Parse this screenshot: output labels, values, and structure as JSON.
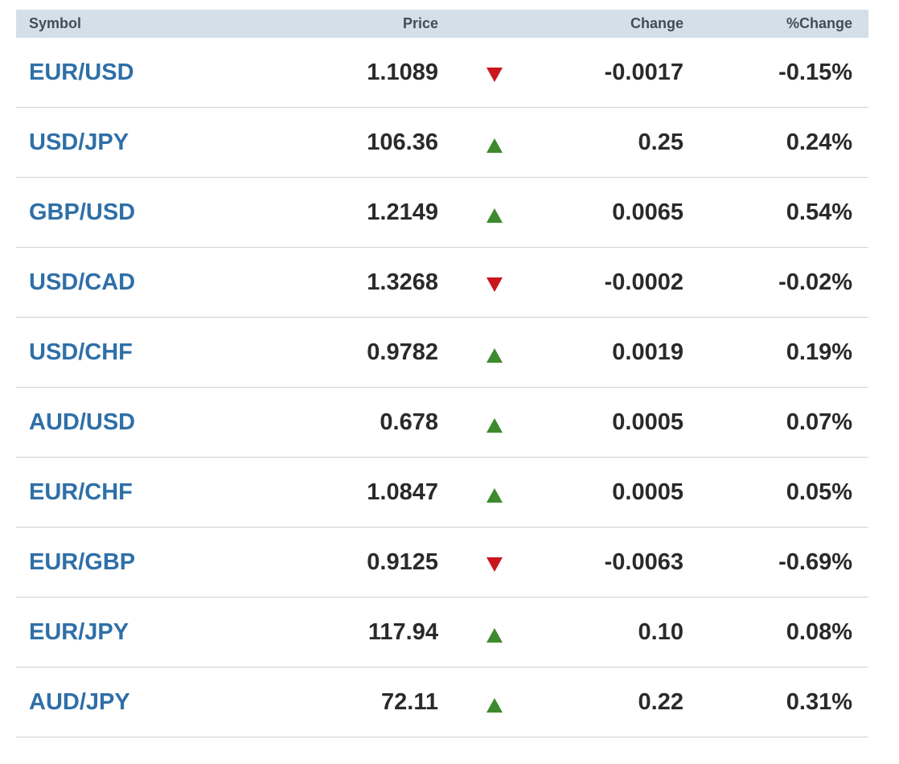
{
  "header": {
    "symbol": "Symbol",
    "price": "Price",
    "change": "Change",
    "pct_change": "%Change"
  },
  "rows": [
    {
      "symbol": "EUR/USD",
      "price": "1.1089",
      "direction": "down",
      "change": "-0.0017",
      "pct": "-0.15%"
    },
    {
      "symbol": "USD/JPY",
      "price": "106.36",
      "direction": "up",
      "change": "0.25",
      "pct": "0.24%"
    },
    {
      "symbol": "GBP/USD",
      "price": "1.2149",
      "direction": "up",
      "change": "0.0065",
      "pct": "0.54%"
    },
    {
      "symbol": "USD/CAD",
      "price": "1.3268",
      "direction": "down",
      "change": "-0.0002",
      "pct": "-0.02%"
    },
    {
      "symbol": "USD/CHF",
      "price": "0.9782",
      "direction": "up",
      "change": "0.0019",
      "pct": "0.19%"
    },
    {
      "symbol": "AUD/USD",
      "price": "0.678",
      "direction": "up",
      "change": "0.0005",
      "pct": "0.07%"
    },
    {
      "symbol": "EUR/CHF",
      "price": "1.0847",
      "direction": "up",
      "change": "0.0005",
      "pct": "0.05%"
    },
    {
      "symbol": "EUR/GBP",
      "price": "0.9125",
      "direction": "down",
      "change": "-0.0063",
      "pct": "-0.69%"
    },
    {
      "symbol": "EUR/JPY",
      "price": "117.94",
      "direction": "up",
      "change": "0.10",
      "pct": "0.08%"
    },
    {
      "symbol": "AUD/JPY",
      "price": "72.11",
      "direction": "up",
      "change": "0.22",
      "pct": "0.31%"
    }
  ],
  "colors": {
    "header_bg": "#d4e0e9",
    "link": "#2f6fa8",
    "up": "#3e8a2e",
    "down": "#c8171e",
    "divider": "#c9d3da"
  }
}
